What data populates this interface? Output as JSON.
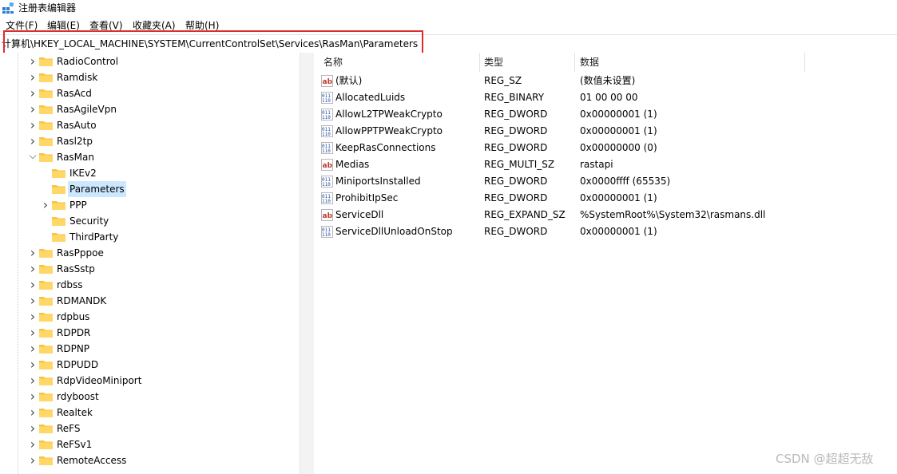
{
  "window": {
    "title": "注册表编辑器",
    "icon": "regedit-icon"
  },
  "menu": [
    "文件(F)",
    "编辑(E)",
    "查看(V)",
    "收藏夹(A)",
    "帮助(H)"
  ],
  "address": {
    "path": "计算机\\HKEY_LOCAL_MACHINE\\SYSTEM\\CurrentControlSet\\Services\\RasMan\\Parameters",
    "highlight_color": "#e02b2b"
  },
  "tree": [
    {
      "label": "RadioControl",
      "expander": "chevron-right",
      "level": 0
    },
    {
      "label": "Ramdisk",
      "expander": "chevron-right",
      "level": 0
    },
    {
      "label": "RasAcd",
      "expander": "chevron-right",
      "level": 0
    },
    {
      "label": "RasAgileVpn",
      "expander": "chevron-right",
      "level": 0
    },
    {
      "label": "RasAuto",
      "expander": "chevron-right",
      "level": 0
    },
    {
      "label": "Rasl2tp",
      "expander": "chevron-right",
      "level": 0
    },
    {
      "label": "RasMan",
      "expander": "chevron-down",
      "level": 0
    },
    {
      "label": "IKEv2",
      "expander": "none",
      "level": 1
    },
    {
      "label": "Parameters",
      "expander": "none",
      "level": 1,
      "selected": true
    },
    {
      "label": "PPP",
      "expander": "chevron-right",
      "level": 1
    },
    {
      "label": "Security",
      "expander": "none",
      "level": 1
    },
    {
      "label": "ThirdParty",
      "expander": "none",
      "level": 1
    },
    {
      "label": "RasPppoe",
      "expander": "chevron-right",
      "level": 0
    },
    {
      "label": "RasSstp",
      "expander": "chevron-right",
      "level": 0
    },
    {
      "label": "rdbss",
      "expander": "chevron-right",
      "level": 0
    },
    {
      "label": "RDMANDK",
      "expander": "chevron-right",
      "level": 0
    },
    {
      "label": "rdpbus",
      "expander": "chevron-right",
      "level": 0
    },
    {
      "label": "RDPDR",
      "expander": "chevron-right",
      "level": 0
    },
    {
      "label": "RDPNP",
      "expander": "chevron-right",
      "level": 0
    },
    {
      "label": "RDPUDD",
      "expander": "chevron-right",
      "level": 0
    },
    {
      "label": "RdpVideoMiniport",
      "expander": "chevron-right",
      "level": 0
    },
    {
      "label": "rdyboost",
      "expander": "chevron-right",
      "level": 0
    },
    {
      "label": "Realtek",
      "expander": "chevron-right",
      "level": 0
    },
    {
      "label": "ReFS",
      "expander": "chevron-right",
      "level": 0
    },
    {
      "label": "ReFSv1",
      "expander": "chevron-right",
      "level": 0
    },
    {
      "label": "RemoteAccess",
      "expander": "chevron-right",
      "level": 0
    }
  ],
  "columns": [
    "名称",
    "类型",
    "数据"
  ],
  "values": [
    {
      "icon": "string-value-icon",
      "name": "(默认)",
      "type": "REG_SZ",
      "data": "(数值未设置)"
    },
    {
      "icon": "binary-value-icon",
      "name": "AllocatedLuids",
      "type": "REG_BINARY",
      "data": "01 00 00 00"
    },
    {
      "icon": "binary-value-icon",
      "name": "AllowL2TPWeakCrypto",
      "type": "REG_DWORD",
      "data": "0x00000001 (1)"
    },
    {
      "icon": "binary-value-icon",
      "name": "AllowPPTPWeakCrypto",
      "type": "REG_DWORD",
      "data": "0x00000001 (1)"
    },
    {
      "icon": "binary-value-icon",
      "name": "KeepRasConnections",
      "type": "REG_DWORD",
      "data": "0x00000000 (0)"
    },
    {
      "icon": "string-value-icon",
      "name": "Medias",
      "type": "REG_MULTI_SZ",
      "data": "rastapi"
    },
    {
      "icon": "binary-value-icon",
      "name": "MiniportsInstalled",
      "type": "REG_DWORD",
      "data": "0x0000ffff (65535)"
    },
    {
      "icon": "binary-value-icon",
      "name": "ProhibitIpSec",
      "type": "REG_DWORD",
      "data": "0x00000001 (1)"
    },
    {
      "icon": "string-value-icon",
      "name": "ServiceDll",
      "type": "REG_EXPAND_SZ",
      "data": "%SystemRoot%\\System32\\rasmans.dll"
    },
    {
      "icon": "binary-value-icon",
      "name": "ServiceDllUnloadOnStop",
      "type": "REG_DWORD",
      "data": "0x00000001 (1)"
    }
  ],
  "watermark": "CSDN @超超无敌",
  "colors": {
    "folder": "#f4c542",
    "selection": "#cce8ff",
    "highlight_box": "#e02b2b"
  }
}
